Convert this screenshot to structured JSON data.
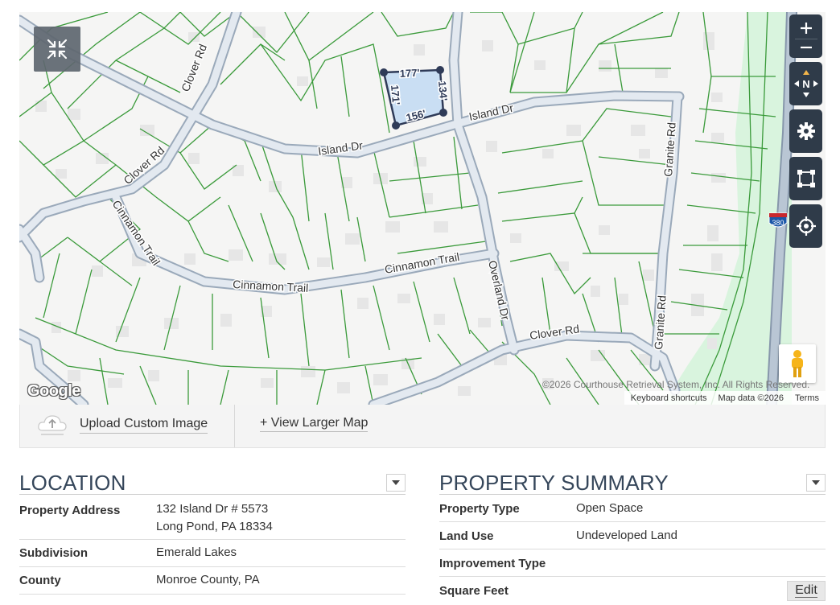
{
  "map": {
    "street_labels": {
      "island_dr_1": "Island Dr",
      "island_dr_2": "Island Dr",
      "clover_rd_1": "Clover Rd",
      "clover_rd_2": "Clover Rd",
      "clover_rd_3": "Clover Rd",
      "cinnamon_trail_1": "Cinnamon Trail",
      "cinnamon_trail_2": "Cinnamon Trail",
      "cinnamon_trail_3": "Cinnamon Trail",
      "overland_dr": "Overland Dr",
      "granite_rd_1": "Granite Rd",
      "granite_rd_2": "Granite Rd",
      "interstate": "380"
    },
    "parcel_dimensions": {
      "top": "177'",
      "right": "134'",
      "bottom": "156'",
      "left": "171'"
    },
    "google_logo": "Google",
    "copyright": "©2026 Courthouse Retrieval System, Inc. All Rights Reserved.",
    "attribution": {
      "keyboard_shortcuts": "Keyboard shortcuts",
      "map_data": "Map data ©2026",
      "terms": "Terms"
    },
    "controls": {
      "compass_label": "N"
    },
    "colors": {
      "parcel_line": "#3a9a3a",
      "road": "#c3cfdc",
      "green_area": "#d6f3dc",
      "selected_parcel": "#c9def3",
      "control_bg": "#2f3b49"
    }
  },
  "map_bar": {
    "upload_label": "Upload Custom Image",
    "larger_map_label": "+ View Larger Map"
  },
  "location": {
    "title": "LOCATION",
    "property_address_label": "Property Address",
    "property_address_line1": "132 Island Dr # 5573",
    "property_address_line2": "Long Pond, PA 18334",
    "subdivision_label": "Subdivision",
    "subdivision_value": "Emerald Lakes",
    "county_label": "County",
    "county_value": "Monroe County, PA"
  },
  "summary": {
    "title": "PROPERTY SUMMARY",
    "property_type_label": "Property Type",
    "property_type_value": "Open Space",
    "land_use_label": "Land Use",
    "land_use_value": "Undeveloped Land",
    "improvement_type_label": "Improvement Type",
    "improvement_type_value": "",
    "square_feet_label": "Square Feet",
    "edit_label": "Edit"
  }
}
